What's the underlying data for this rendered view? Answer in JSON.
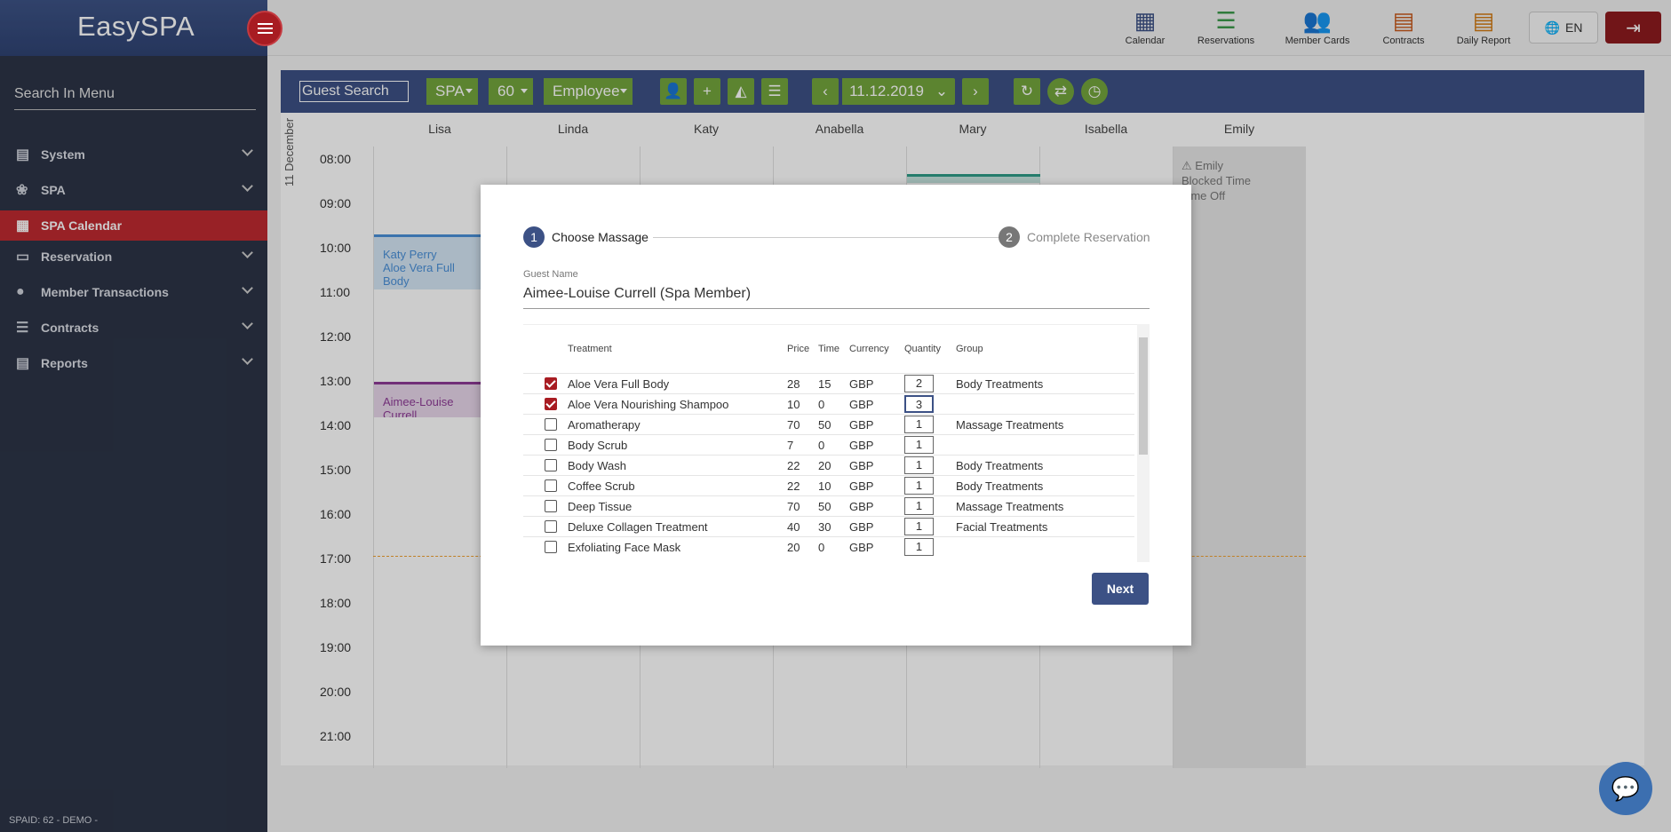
{
  "app": {
    "name": "EasySPA",
    "footer": "SPAID: 62 - DEMO -"
  },
  "sidebar": {
    "search_placeholder": "Search In Menu",
    "items": [
      {
        "label": "System",
        "icon": "document-icon"
      },
      {
        "label": "SPA",
        "icon": "lotus-icon"
      },
      {
        "label": "SPA Calendar",
        "icon": "calendar-icon",
        "active": true
      },
      {
        "label": "Reservation",
        "icon": "monitor-icon"
      },
      {
        "label": "Member Transactions",
        "icon": "person-icon"
      },
      {
        "label": "Contracts",
        "icon": "list-icon"
      },
      {
        "label": "Reports",
        "icon": "report-icon"
      }
    ]
  },
  "topnav": {
    "items": [
      {
        "label": "Calendar",
        "icon": "calendar-icon",
        "color": "#3c5185"
      },
      {
        "label": "Reservations",
        "icon": "list-icon",
        "color": "#3d9a4c"
      },
      {
        "label": "Member Cards",
        "icon": "people-icon",
        "color": "#7b2d8e"
      },
      {
        "label": "Contracts",
        "icon": "contract-icon",
        "color": "#c75a1d"
      },
      {
        "label": "Daily Report",
        "icon": "report-icon",
        "color": "#d27b14"
      }
    ],
    "language": "EN"
  },
  "toolbar": {
    "guest_search_placeholder": "Guest Search",
    "spa_select": "SPA",
    "duration_select": "60",
    "employee_select": "Employee",
    "date": "11.12.2019"
  },
  "calendar": {
    "date_label": "11 December",
    "employees": [
      "Lisa",
      "Linda",
      "Katy",
      "Anabella",
      "Mary",
      "Isabella",
      "Emily"
    ],
    "times": [
      "08:00",
      "09:00",
      "10:00",
      "11:00",
      "12:00",
      "13:00",
      "14:00",
      "15:00",
      "16:00",
      "17:00",
      "18:00",
      "19:00",
      "20:00",
      "21:00"
    ],
    "events": [
      {
        "name": "Katy Perry",
        "treatment": "Aloe Vera Full Body"
      },
      {
        "name": "Aimee-Louise Currell"
      }
    ],
    "blocked": {
      "name": "Emily",
      "line1": "Blocked Time",
      "line2": "Time Off"
    }
  },
  "dialog": {
    "step1": "Choose Massage",
    "step2": "Complete Reservation",
    "guest_label": "Guest Name",
    "guest_name": "Aimee-Louise Currell (Spa Member)",
    "headers": {
      "treatment": "Treatment",
      "price": "Price",
      "time": "Time",
      "currency": "Currency",
      "quantity": "Quantity",
      "group": "Group"
    },
    "rows": [
      {
        "checked": true,
        "treatment": "Aloe Vera Full Body",
        "price": "28",
        "time": "15",
        "currency": "GBP",
        "qty": "2",
        "group": "Body Treatments"
      },
      {
        "checked": true,
        "treatment": "Aloe Vera Nourishing Shampoo",
        "price": "10",
        "time": "0",
        "currency": "GBP",
        "qty": "3",
        "group": ""
      },
      {
        "checked": false,
        "treatment": "Aromatherapy",
        "price": "70",
        "time": "50",
        "currency": "GBP",
        "qty": "1",
        "group": "Massage Treatments"
      },
      {
        "checked": false,
        "treatment": "Body Scrub",
        "price": "7",
        "time": "0",
        "currency": "GBP",
        "qty": "1",
        "group": ""
      },
      {
        "checked": false,
        "treatment": "Body Wash",
        "price": "22",
        "time": "20",
        "currency": "GBP",
        "qty": "1",
        "group": "Body Treatments"
      },
      {
        "checked": false,
        "treatment": "Coffee Scrub",
        "price": "22",
        "time": "10",
        "currency": "GBP",
        "qty": "1",
        "group": "Body Treatments"
      },
      {
        "checked": false,
        "treatment": "Deep Tissue",
        "price": "70",
        "time": "50",
        "currency": "GBP",
        "qty": "1",
        "group": "Massage Treatments"
      },
      {
        "checked": false,
        "treatment": "Deluxe Collagen Treatment",
        "price": "40",
        "time": "30",
        "currency": "GBP",
        "qty": "1",
        "group": "Facial Treatments"
      },
      {
        "checked": false,
        "treatment": "Exfoliating Face Mask",
        "price": "20",
        "time": "0",
        "currency": "GBP",
        "qty": "1",
        "group": ""
      }
    ],
    "next": "Next"
  }
}
